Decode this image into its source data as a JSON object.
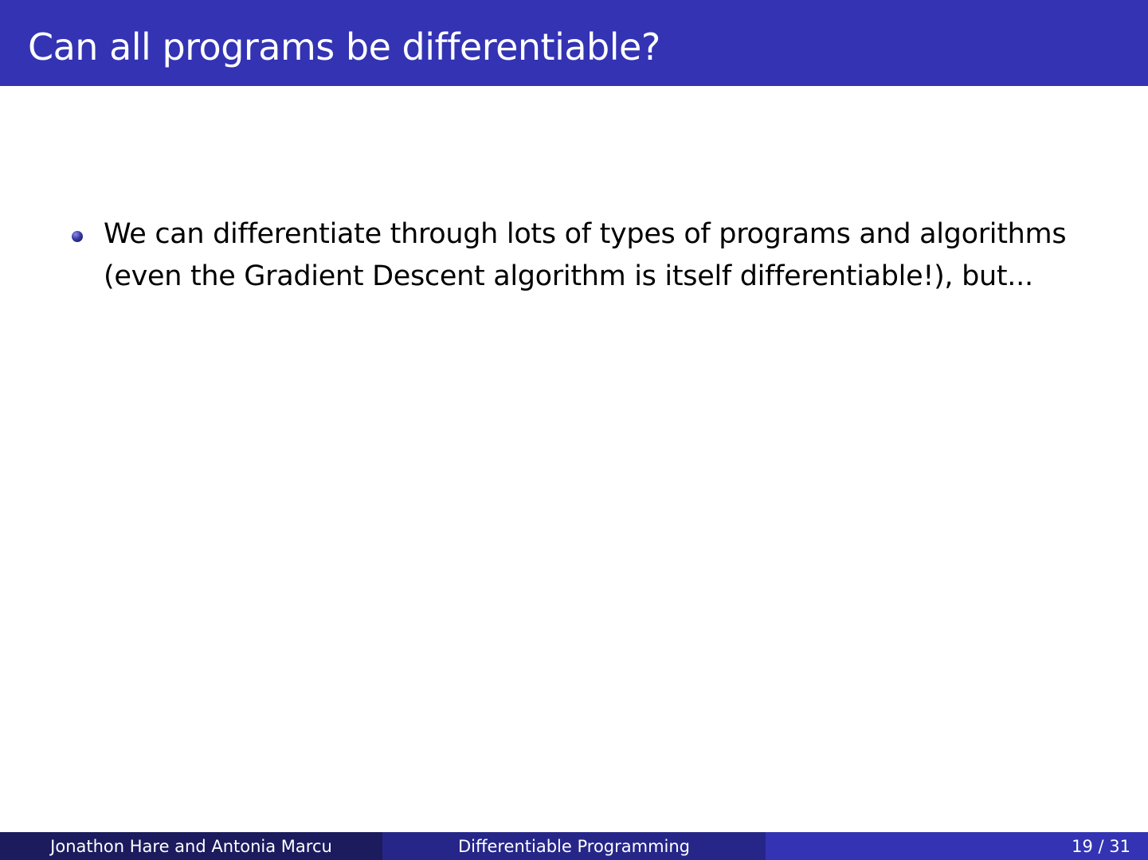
{
  "slide": {
    "title": "Can all programs be differentiable?",
    "bullets": [
      {
        "text": "We can differentiate through lots of types of programs and algorithms (even the Gradient Descent algorithm is itself differentiable!), but..."
      }
    ]
  },
  "footer": {
    "authors": "Jonathon Hare and Antonia Marcu",
    "talk_title": "Differentiable Programming",
    "page": "19 / 31"
  },
  "colors": {
    "title_bar": "#3333b3",
    "footer_left": "#1b1b5e",
    "footer_middle": "#262689",
    "footer_right": "#3333b3",
    "bullet": "#3a3aa8"
  },
  "icons": {
    "bullet": "bullet-ball-icon"
  }
}
